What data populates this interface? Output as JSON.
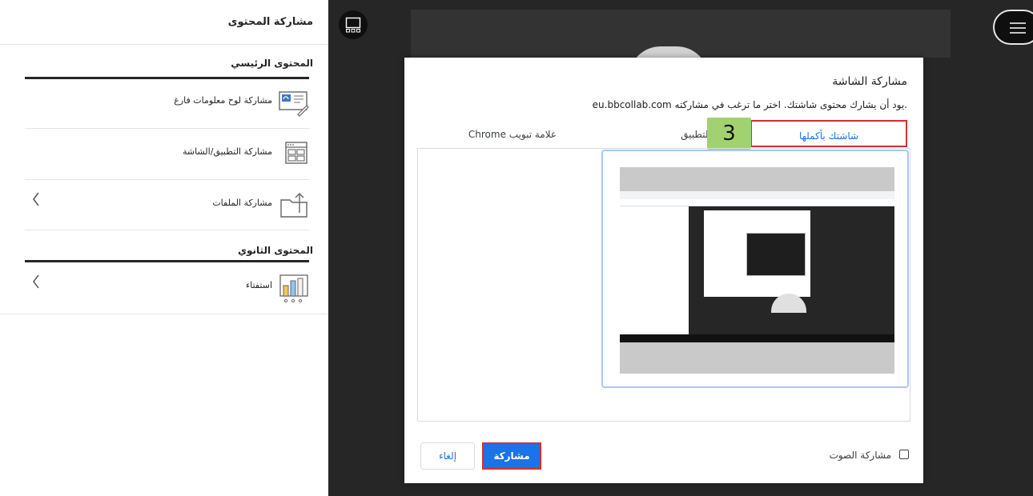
{
  "panel": {
    "title": "مشاركة المحتوى",
    "primary_title": "المحتوى الرئيسي",
    "secondary_title": "المحتوى الثانوي",
    "items": [
      {
        "label": "مشاركة لوح معلومات فارغ",
        "icon": "whiteboard-icon"
      },
      {
        "label": "مشاركة التطبيق/الشاشة",
        "icon": "application-window-icon"
      },
      {
        "label": "مشاركة الملفات",
        "icon": "folder-upload-icon"
      },
      {
        "label": "استفتاء",
        "icon": "poll-chart-icon"
      }
    ]
  },
  "stage": {
    "layout_icon": "layout-icon",
    "menu_icon": "hamburger-menu-icon"
  },
  "dialog": {
    "title": "مشاركة الشاشة",
    "subtitle": ".يود أن يشارك محتوى شاشتك. اختر ما ترغب في مشاركته eu.bbcollab.com",
    "tabs": {
      "entire_screen": "شاشتك بأكملها",
      "app_window": "نافذة التطبيق",
      "chrome_tab": "علامة تبويب Chrome"
    },
    "step_badge": "3",
    "share_button": "مشاركة",
    "cancel_button": "إلغاء",
    "audio_label": "مشاركة الصوت",
    "audio_checked": false
  },
  "colors": {
    "accent": "#1a73e8",
    "highlight": "#d32f2f",
    "badge": "#a2d26f",
    "stage": "#262626"
  }
}
